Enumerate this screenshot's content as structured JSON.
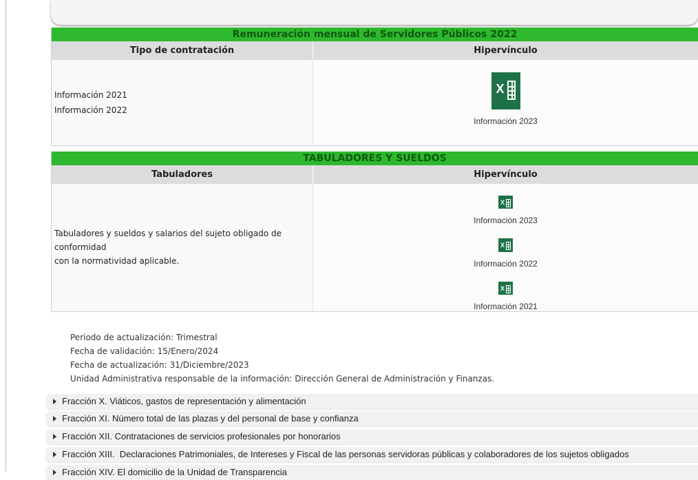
{
  "remuneracion": {
    "title": "Remuneración mensual de Servidores Públicos 2022",
    "col1_header": "Tipo de contratación",
    "col2_header": "Hipervínculo",
    "items": [
      "Información 2021",
      "Información 2022"
    ],
    "link_label": "Información 2023",
    "link_icon": "excel-icon"
  },
  "tabuladores": {
    "title": "TABULADORES Y SUELDOS",
    "col1_header": "Tabuladores",
    "col2_header": "Hipervínculo",
    "description_line1": "Tabuladores y sueldos y salarios del sujeto obligado de conformidad",
    "description_line2": "con la normatividad aplicable.",
    "links": [
      {
        "label": "Información 2023",
        "icon": "excel-icon"
      },
      {
        "label": "Información 2022",
        "icon": "excel-icon"
      },
      {
        "label": "Información 2021",
        "icon": "excel-icon"
      }
    ]
  },
  "meta": {
    "periodo": "Periodo de actualización: Trimestral",
    "validacion": "Fecha de validación: 15/Enero/2024",
    "actualizacion": "Fecha de actualización: 31/Diciembre/2023",
    "unidad": "Unidad Administrativa responsable de la información: Dirección General de Administración y Finanzas."
  },
  "accordion": [
    "Fracción X. Viáticos, gastos de representación y alimentación",
    "Fracción XI. Número total de las plazas y del personal de base y confianza",
    "Fracción XII. Contrataciones de servicios profesionales por honorarios",
    "Fracción XIII.  Declaraciones Patrimoniales, de Intereses y Fiscal de las personas servidoras públicas y colaboradores de los sujetos obligados",
    "Fracción XIV. El domicilio de la Unidad de Transparencia"
  ],
  "colors": {
    "header_green": "#2eb82e",
    "excel_green": "#1f7246",
    "header_gray": "#dcdcdc"
  }
}
